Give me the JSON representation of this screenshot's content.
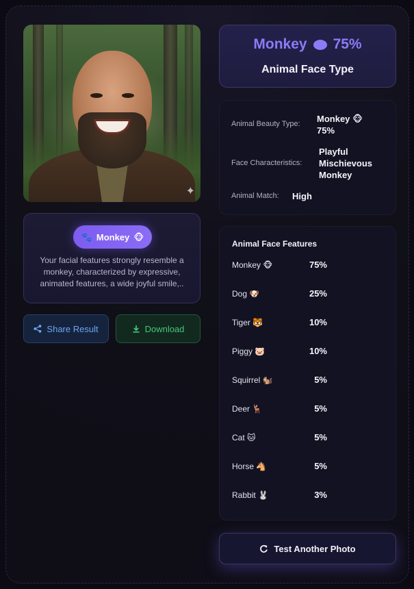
{
  "result": {
    "headline_name": "Monkey",
    "headline_percent": "75%",
    "subtitle": "Animal Face Type"
  },
  "badge": {
    "icon": "🐾",
    "label": "Monkey",
    "emoji": "🐵"
  },
  "description": "Your facial features strongly resemble a monkey, characterized by expressive, animated features, a wide joyful smile,..",
  "actions": {
    "share_label": "Share Result",
    "download_label": "Download",
    "retry_label": "Test Another Photo"
  },
  "info": {
    "beauty_type_label": "Animal Beauty Type:",
    "beauty_type_value_1": "Monkey 🐵",
    "beauty_type_value_2": "75%",
    "characteristics_label": "Face Characteristics:",
    "characteristics_value_1": "Playful",
    "characteristics_value_2": "Mischievous",
    "characteristics_value_3": "Monkey",
    "match_label": "Animal Match:",
    "match_value": "High"
  },
  "features": {
    "title": "Animal Face Features",
    "items": [
      {
        "name": "Monkey 🐵",
        "value": "75%"
      },
      {
        "name": "Dog 🐶",
        "value": "25%"
      },
      {
        "name": "Tiger 🐯",
        "value": "10%"
      },
      {
        "name": "Piggy 🐷",
        "value": "10%"
      },
      {
        "name": "Squirrel 🐿️",
        "value": "5%"
      },
      {
        "name": "Deer 🦌",
        "value": "5%"
      },
      {
        "name": "Cat 🐱",
        "value": "5%"
      },
      {
        "name": "Horse 🐴",
        "value": "5%"
      },
      {
        "name": "Rabbit 🐰",
        "value": "3%"
      }
    ]
  },
  "colors": {
    "accent": "#8a7cf7",
    "share": "#6ea4f3",
    "download": "#42c779"
  }
}
